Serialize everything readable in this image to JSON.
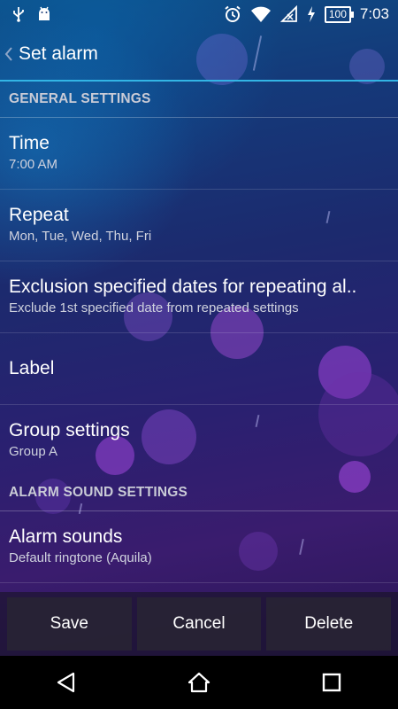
{
  "status_bar": {
    "time": "7:03",
    "battery": "100",
    "icons": [
      "usb-icon",
      "android-icon",
      "alarm-clock-icon",
      "wifi-icon",
      "no-signal-icon",
      "charging-icon"
    ]
  },
  "action_bar": {
    "title": "Set alarm"
  },
  "sections": {
    "general": "GENERAL SETTINGS",
    "sound": "ALARM SOUND SETTINGS"
  },
  "items": {
    "time": {
      "title": "Time",
      "summary": "7:00 AM"
    },
    "repeat": {
      "title": "Repeat",
      "summary": "Mon, Tue, Wed, Thu, Fri"
    },
    "exclusion": {
      "title": "Exclusion specified dates for repeating al..",
      "summary": "Exclude 1st specified date from repeated settings"
    },
    "label": {
      "title": "Label"
    },
    "group": {
      "title": "Group settings",
      "summary": "Group A"
    },
    "alarm_sounds": {
      "title": "Alarm sounds",
      "summary": "Default ringtone (Aquila)"
    }
  },
  "buttons": {
    "save": "Save",
    "cancel": "Cancel",
    "delete": "Delete"
  },
  "colors": {
    "accent": "#33b5e5"
  }
}
